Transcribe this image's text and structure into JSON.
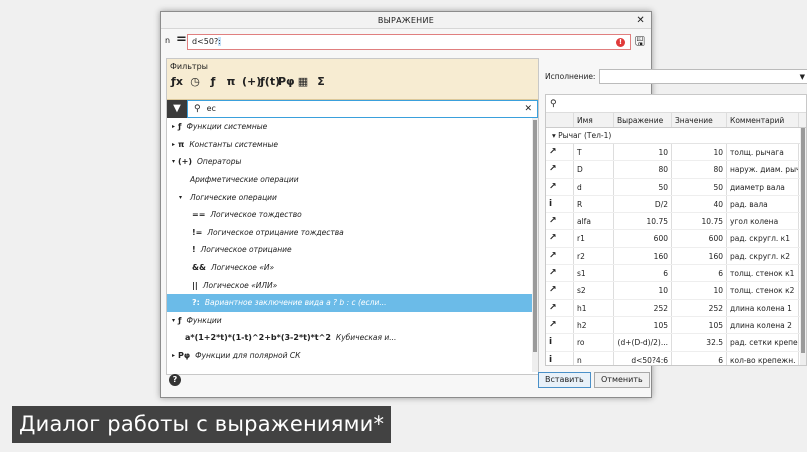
{
  "dialog": {
    "title": "ВЫРАЖЕНИЕ",
    "expression": {
      "label": "n",
      "value": "d<50?",
      "selection": ":"
    },
    "filters": {
      "label": "Фильтры",
      "icons": [
        "ƒx",
        "◷",
        "ƒ",
        "π",
        "(+)",
        "ƒ(t)",
        "Pφ",
        "▦",
        "Σ"
      ]
    },
    "search": {
      "value": "ec"
    },
    "tree": [
      {
        "caret": "▸",
        "icon": "ƒ",
        "label": "Функции системные",
        "indent": 0
      },
      {
        "caret": "▸",
        "icon": "π",
        "label": "Константы системные",
        "indent": 0
      },
      {
        "caret": "▾",
        "icon": "(+)",
        "label": "Операторы",
        "indent": 0
      },
      {
        "caret": "",
        "icon": "",
        "label": "Арифметические операции",
        "indent": 1
      },
      {
        "caret": "▾",
        "icon": "",
        "label": "Логические операции",
        "indent": 1
      },
      {
        "caret": "",
        "icon": "==",
        "label": "Логическое тождество",
        "indent": 2
      },
      {
        "caret": "",
        "icon": "!=",
        "label": "Логическое отрицание тождества",
        "indent": 2
      },
      {
        "caret": "",
        "icon": "!",
        "label": "Логическое отрицание",
        "indent": 2
      },
      {
        "caret": "",
        "icon": "&&",
        "label": "Логическое «И»",
        "indent": 2
      },
      {
        "caret": "",
        "icon": "||",
        "label": "Логическое «ИЛИ»",
        "indent": 2
      },
      {
        "caret": "",
        "icon": "?:",
        "label": "Вариантное заключение вида a ? b : c (если...",
        "indent": 2,
        "selected": true
      },
      {
        "caret": "▾",
        "icon": "ƒ",
        "label": "Функции",
        "indent": 0
      },
      {
        "caret": "",
        "icon": "a*(1+2*t)*(1-t)^2+b*(3-2*t)*t^2",
        "label": "Кубическая и...",
        "indent": 1
      },
      {
        "caret": "▸",
        "icon": "Pφ",
        "label": "Функции для полярной СК",
        "indent": 0
      }
    ],
    "execution": {
      "label": "Исполнение:",
      "value": ""
    },
    "variables": {
      "columns": [
        "",
        "Имя",
        "Выражение",
        "Значение",
        "Комментарий"
      ],
      "group": "Рычаг (Тел-1)",
      "rows": [
        {
          "icon": "↗",
          "name": "T",
          "expr": "10",
          "value": "10",
          "comment": "толщ. рычага"
        },
        {
          "icon": "↗",
          "name": "D",
          "expr": "80",
          "value": "80",
          "comment": "наруж. диам. рыч"
        },
        {
          "icon": "↗",
          "name": "d",
          "expr": "50",
          "value": "50",
          "comment": "диаметр вала"
        },
        {
          "icon": "i",
          "name": "R",
          "expr": "D/2",
          "value": "40",
          "comment": "рад. вала"
        },
        {
          "icon": "↗",
          "name": "alfa",
          "expr": "10.75",
          "value": "10.75",
          "comment": "угол колена"
        },
        {
          "icon": "↗",
          "name": "r1",
          "expr": "600",
          "value": "600",
          "comment": "рад. скругл. к1"
        },
        {
          "icon": "↗",
          "name": "r2",
          "expr": "160",
          "value": "160",
          "comment": "рад. скругл. к2"
        },
        {
          "icon": "↗",
          "name": "s1",
          "expr": "6",
          "value": "6",
          "comment": "толщ. стенок к1"
        },
        {
          "icon": "↗",
          "name": "s2",
          "expr": "10",
          "value": "10",
          "comment": "толщ. стенок к2"
        },
        {
          "icon": "↗",
          "name": "h1",
          "expr": "252",
          "value": "252",
          "comment": "длина колена 1"
        },
        {
          "icon": "↗",
          "name": "h2",
          "expr": "105",
          "value": "105",
          "comment": "длина колена 2"
        },
        {
          "icon": "i",
          "name": "ro",
          "expr": "(d+(D-d)/2)...",
          "value": "32.5",
          "comment": "рад. сетки крепеж"
        },
        {
          "icon": "i",
          "name": "n",
          "expr": "d<50?4:6",
          "value": "6",
          "comment": "кол-во крепежн."
        }
      ]
    },
    "buttons": {
      "insert": "Вставить",
      "cancel": "Отменить"
    }
  },
  "caption": "Диалог работы с выражениями*"
}
